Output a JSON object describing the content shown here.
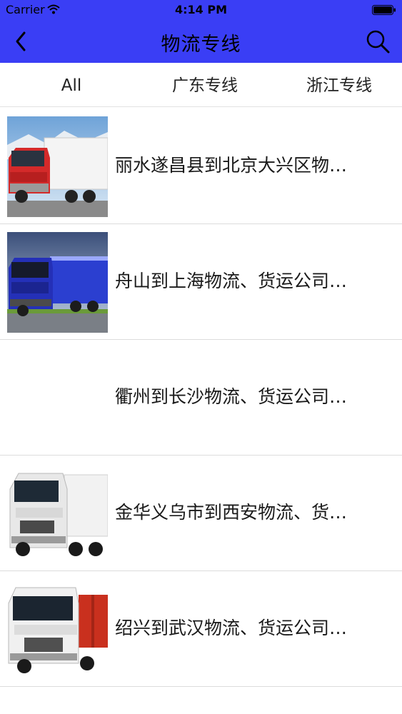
{
  "status_bar": {
    "carrier": "Carrier",
    "time": "4:14 PM"
  },
  "nav": {
    "title": "物流专线"
  },
  "tabs": [
    {
      "label": "All"
    },
    {
      "label": "广东专线"
    },
    {
      "label": "浙江专线"
    }
  ],
  "items": [
    {
      "title": "丽水遂昌县到北京大兴区物…",
      "truck_color": "#d42a2a"
    },
    {
      "title": "舟山到上海物流、货运公司…",
      "truck_color": "#2430b8"
    },
    {
      "title": "衢州到长沙物流、货运公司…"
    },
    {
      "title": "金华义乌市到西安物流、货…",
      "truck_color": "#e8e8e8"
    },
    {
      "title": "绍兴到武汉物流、货运公司…",
      "truck_color": "#f0f0f0"
    }
  ],
  "colors": {
    "header_bg": "#3a3ef5"
  }
}
